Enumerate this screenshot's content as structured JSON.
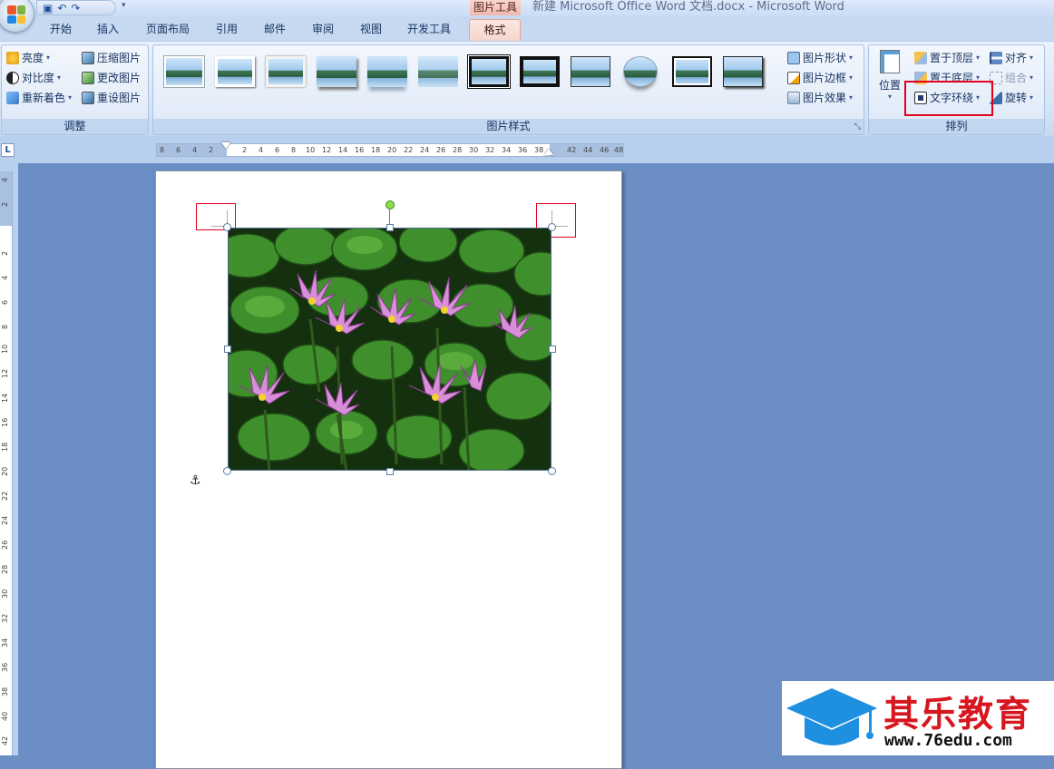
{
  "window": {
    "title": "新建 Microsoft Office Word 文档.docx - Microsoft Word",
    "context_tab": "图片工具"
  },
  "quick_access": {
    "save_icon": "save-icon",
    "undo_icon": "undo-icon",
    "redo_icon": "redo-icon"
  },
  "tabs": [
    "开始",
    "插入",
    "页面布局",
    "引用",
    "邮件",
    "审阅",
    "视图",
    "开发工具",
    "格式"
  ],
  "active_tab": "格式",
  "adjust_group": {
    "label": "调整",
    "brightness": "亮度",
    "contrast": "对比度",
    "recolor": "重新着色",
    "compress": "压缩图片",
    "change": "更改图片",
    "reset": "重设图片"
  },
  "styles_group": {
    "label": "图片样式",
    "shape": "图片形状",
    "border": "图片边框",
    "effects": "图片效果"
  },
  "arrange_group": {
    "label": "排列",
    "position": "位置",
    "bring_front": "置于顶层",
    "send_back": "置于底层",
    "text_wrap": "文字环绕",
    "align": "对齐",
    "group": "组合",
    "rotate": "旋转"
  },
  "ruler_h": [
    "8",
    "6",
    "4",
    "2",
    "2",
    "4",
    "6",
    "8",
    "10",
    "12",
    "14",
    "16",
    "18",
    "20",
    "22",
    "24",
    "26",
    "28",
    "30",
    "32",
    "34",
    "36",
    "38",
    "42",
    "44",
    "46",
    "48"
  ],
  "ruler_v": [
    "4",
    "2",
    "2",
    "4",
    "6",
    "8",
    "10",
    "12",
    "14",
    "16",
    "18",
    "20",
    "22",
    "24",
    "26",
    "28",
    "30",
    "32",
    "34",
    "36",
    "38",
    "40",
    "42"
  ],
  "ruler_corner": "L",
  "watermark": {
    "brand": "其乐教育",
    "url": "www.76edu.com"
  },
  "colors": {
    "highlight": "#e2001a",
    "brand_red": "#d7171f",
    "brand_blue": "#1f8fe0"
  }
}
